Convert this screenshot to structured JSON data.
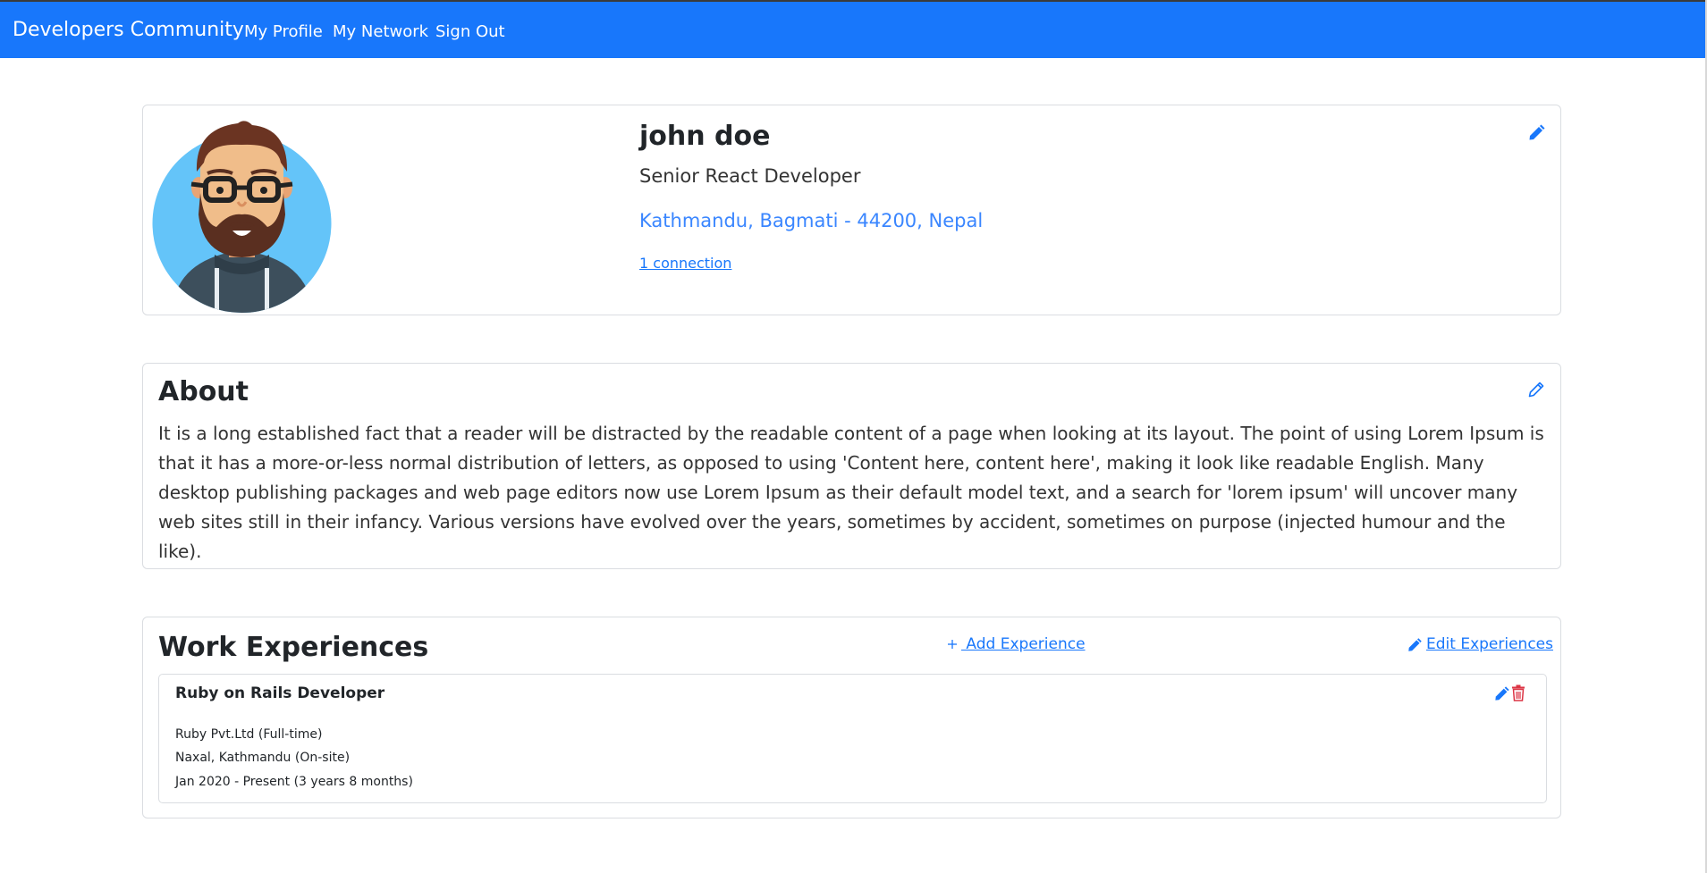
{
  "navbar": {
    "brand": "Developers Community",
    "links": [
      "My Profile",
      "My Network",
      "Sign Out"
    ]
  },
  "profile": {
    "name": "john doe",
    "headline": "Senior React Developer",
    "location": "Kathmandu, Bagmati - 44200, Nepal",
    "connections": "1 connection",
    "edit_icon": "pencil-icon"
  },
  "about": {
    "title": "About",
    "text": "It is a long established fact that a reader will be distracted by the readable content of a page when looking at its layout. The point of using Lorem Ipsum is that it has a more-or-less normal distribution of letters, as opposed to using 'Content here, content here', making it look like readable English. Many desktop publishing packages and web page editors now use Lorem Ipsum as their default model text, and a search for 'lorem ipsum' will uncover many web sites still in their infancy. Various versions have evolved over the years, sometimes by accident, sometimes on purpose (injected humour and the like).",
    "edit_icon": "pencil-outline-icon"
  },
  "work": {
    "title": "Work Experiences",
    "add_label": " Add Experience",
    "edit_label": "Edit Experiences",
    "experiences": [
      {
        "title": "Ruby on Rails Developer",
        "company": "Ruby Pvt.Ltd (Full-time)",
        "location": "Naxal, Kathmandu (On-site)",
        "dates": "Jan 2020 - Present (3 years 8 months)"
      }
    ]
  },
  "colors": {
    "navbar": "#1877fb",
    "link": "#1877fb",
    "location": "#3a86ff",
    "delete": "#dc3545",
    "avatar_bg": "#64c4f9"
  }
}
